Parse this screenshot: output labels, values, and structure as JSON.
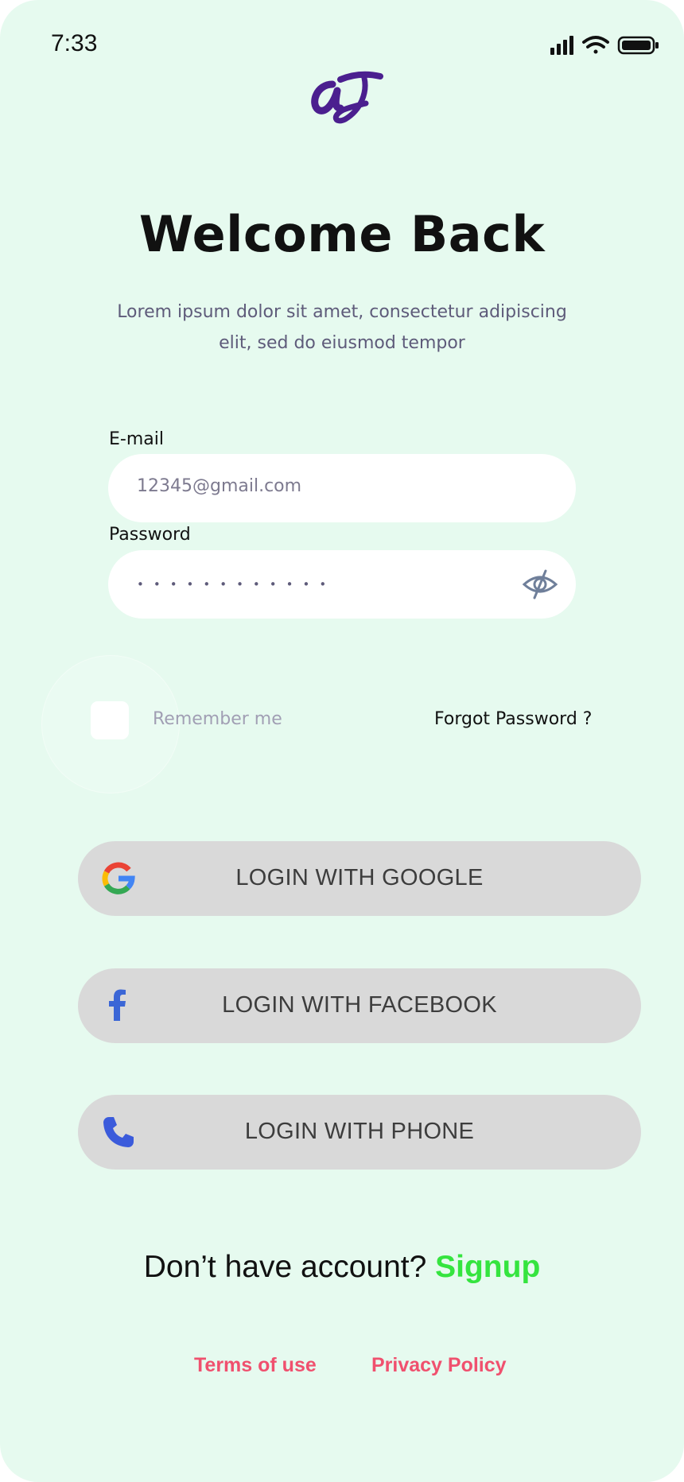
{
  "status_bar": {
    "time": "7:33",
    "icons": [
      "signal-icon",
      "wifi-icon",
      "battery-icon"
    ]
  },
  "logo": {
    "text": "aj",
    "color": "#4b1f8f"
  },
  "header": {
    "title": "Welcome Back",
    "subtitle": "Lorem ipsum dolor sit amet, consectetur adipiscing elit, sed do eiusmod tempor"
  },
  "form": {
    "email_label": "E-mail",
    "email_value": "12345@gmail.com",
    "password_label": "Password",
    "password_value": "••••••••••••",
    "password_toggle_icon": "eye-off-icon",
    "remember_label": "Remember me",
    "remember_checked": false,
    "forgot_label": "Forgot Password ?"
  },
  "social_buttons": [
    {
      "label": "LOGIN WITH GOOGLE",
      "icon": "google-icon"
    },
    {
      "label": "LOGIN WITH FACEBOOK",
      "icon": "facebook-icon"
    },
    {
      "label": "LOGIN WITH PHONE",
      "icon": "phone-icon"
    }
  ],
  "signup": {
    "prompt": "Don’t have account?",
    "link": "Signup"
  },
  "footer": {
    "terms": "Terms of use",
    "privacy": "Privacy Policy"
  },
  "colors": {
    "background": "#e6faef",
    "signup_accent": "#35e43f",
    "footer_link": "#f0506e",
    "button_bg": "#d9d9d9",
    "brand": "#4b1f8f"
  }
}
